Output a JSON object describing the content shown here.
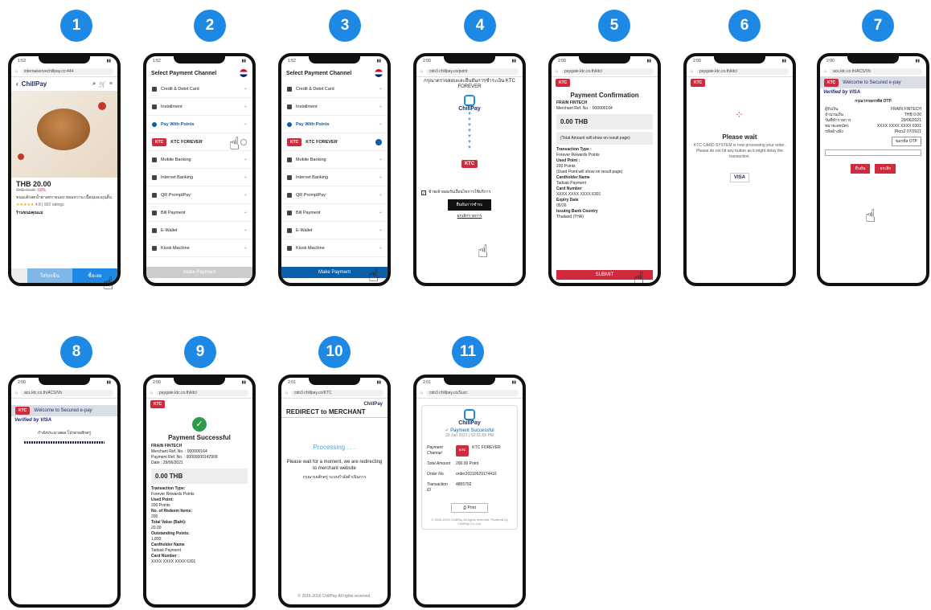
{
  "steps": [
    "1",
    "2",
    "3",
    "4",
    "5",
    "6",
    "7",
    "8",
    "9",
    "10",
    "11"
  ],
  "p1": {
    "time": "1:53",
    "url": "internalservechillpay.co:444",
    "brand": "ChillPay",
    "price": "THB 20.00",
    "old_price": "THB 40.00",
    "discount": "-50%",
    "rating": "4.8 | 902 ratings",
    "desc": "ขนมเค้กสดน้ำตาลทรายแดง หอมหวาน เนื้อนุ่มละมุนลิ้น",
    "shop": "ร้านขนมคุณแม่",
    "btn_cart": "ใส่รถเข็น",
    "btn_buy": "ซื้อเลย"
  },
  "channels": {
    "title": "Select Payment Channel",
    "items": [
      "Credit & Debit Card",
      "Installment",
      "Pay With Points",
      "KTC FOREVER",
      "Mobile Banking",
      "Internet Banking",
      "QR PromptPay",
      "Bill Payment",
      "E-Wallet",
      "Kiosk Machine"
    ],
    "button": "Make Payment"
  },
  "p4": {
    "url": "cdn3.chillpay.co/point",
    "heading": "กรุณาตรวจสอบและยืนยันการชำระเงิน KTC FOREVER",
    "brand": "ChillPay",
    "consent": "ข้าพเจ้ายอมรับเงื่อนไขการใช้บริการ",
    "btn": "ยืนยันการชำระ",
    "cancel": "ยกเลิกรายการ"
  },
  "p5": {
    "url": "paygate.ktc.co.th/ktc/",
    "title": "Payment Confirmation",
    "merchant": "FRAIN FINTECH",
    "ref": "Merchant Ref. No. : 000000164",
    "amount": "0.00 THB",
    "note": "(Total Amount will show on result page)",
    "lines": [
      "Transaction Type :",
      "Forever Rewards Points",
      "Used Point :",
      "200 Points",
      "(Used Point will show on result page)",
      "Cardholder Name",
      "Tadsak Payment",
      "Card Number",
      "XXXX XXXX XXXX 6301",
      "Expiry Date",
      "05/26",
      "Issuing Bank Country",
      "Thailand (THA)"
    ],
    "submit": "SUBMIT"
  },
  "p6": {
    "url": "paygate.ktc.co.th/ktc/",
    "title": "Please wait",
    "msg": "KTC CARD SYSTEM is now processing your order. Please do not hit any button as it might delay the transaction.",
    "visa": "VISA"
  },
  "p7": {
    "url": "acs.ktc.co.th/ACS/Vb",
    "welcome": "Welcome to Secured e-pay",
    "vbv": "Verified by VISA",
    "heading": "กรุณากรอกรหัส OTP",
    "rows": [
      [
        "ผู้รับเงิน",
        "FRAIN FINTECH"
      ],
      [
        "จำนวนเงิน",
        "THB 0.00"
      ],
      [
        "วันที่ทำรายการ",
        "29/06/2021"
      ],
      [
        "หมายเลขบัตร",
        "XXXX XXXX XXXX 6301"
      ],
      [
        "รหัสอ้างอิง",
        "Pkcx2 07/2021"
      ]
    ],
    "otp_btn": "ขอรหัส OTP",
    "submit": "ยืนยัน",
    "cancel": "ยกเลิก"
  },
  "p8": {
    "url": "acs.ktc.co.th/ACS/Vb",
    "welcome": "Welcome to Secured e-pay",
    "vbv": "Verified by VISA",
    "msg": "กำลังประมวลผล โปรดรอสักครู่"
  },
  "p9": {
    "url": "paygate.ktc.co.th/ktc/",
    "title": "Payment Successful",
    "merchant": "FRAIN FINTECH",
    "ref": "Merchant Ref. No. : 000000164",
    "pref": "Payment Ref. No. : 00000000142909",
    "date": "Date : 29/06/2021",
    "amount": "0.00 THB",
    "lines": [
      "Transaction Type:",
      "Forever Rewards Points",
      "Used Point:",
      "200 Points",
      "No. of Redeem Items:",
      "200",
      "Total Value (Baht):",
      "20.00",
      "Outstanding Points:",
      "1,893",
      "Cardholder Name",
      "Tadsak Payment",
      "Card Number :",
      "XXXX XXXX XXXX 6301"
    ]
  },
  "p10": {
    "url": "cdn3.chillpay.co/KTC",
    "brand": "ChillPay",
    "title": "REDIRECT to MERCHANT",
    "processing": "Processing . . .",
    "msg": "Please wait for a moment, we are redirecting to merchant website",
    "msg_th": "กรุณารอสักครู่ ระบบกำลังดำเนินการ",
    "footer": "© 2016-2019 ChillPay All rights reserved."
  },
  "p11": {
    "url": "cdn3.chillpay.co/Succ",
    "brand": "ChillPay",
    "title": "Payment Successful",
    "date": "29 Jun 2021 | 02:01:59 PM",
    "rows": [
      [
        "Payment Channel",
        "KTC FOREVER"
      ],
      [
        "Total Amount",
        "200.00 Point"
      ],
      [
        "Order No.",
        "order20210629174416"
      ],
      [
        "Transaction ID",
        "4855792"
      ]
    ],
    "print": "Print",
    "footer": "© 2016-2019 ChillPay All rights reserved. Powered by ChillPay Co.,Ltd."
  },
  "colors": {
    "step": "#1e88e5",
    "ktc": "#d12a3c",
    "blue": "#0b5ea8"
  }
}
